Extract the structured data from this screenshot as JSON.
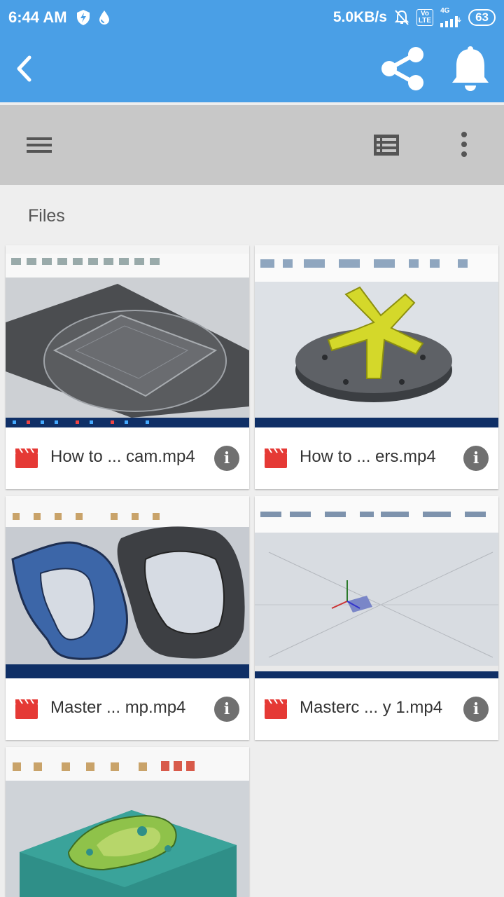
{
  "status_bar": {
    "time": "6:44 AM",
    "network_speed": "5.0KB/s",
    "lte_top": "Vo",
    "lte_bottom": "LTE",
    "signal_type": "4G",
    "battery": "63"
  },
  "app_bar": {
    "back_icon": "back-arrow-icon",
    "share_icon": "share-icon",
    "bell_icon": "bell-icon"
  },
  "toolbar": {
    "menu_icon": "hamburger-menu-icon",
    "list_icon": "list-view-icon",
    "more_icon": "more-vert-icon"
  },
  "section": {
    "label": "Files"
  },
  "files": [
    {
      "name": "How to ... cam.mp4"
    },
    {
      "name": "How to ... ers.mp4"
    },
    {
      "name": "Master ... mp.mp4"
    },
    {
      "name": "Masterc ... y 1.mp4"
    },
    {
      "name": ""
    }
  ],
  "colors": {
    "accent": "#4a9fe6",
    "toolbar": "#c8c8c8",
    "video_red": "#e53935"
  }
}
